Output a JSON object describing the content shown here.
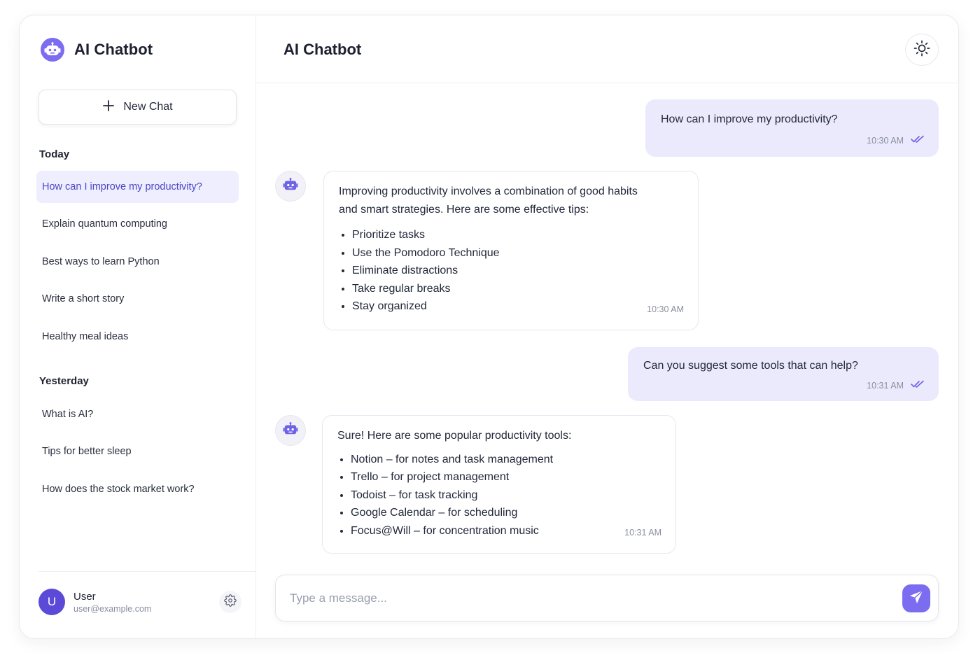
{
  "sidebar": {
    "brand_title": "AI Chatbot",
    "new_chat_label": "New Chat",
    "today_label": "Today",
    "yesterday_label": "Yesterday",
    "today_items": [
      {
        "label": "How can I improve my productivity?",
        "active": true
      },
      {
        "label": "Explain quantum computing"
      },
      {
        "label": "Best ways to learn Python"
      },
      {
        "label": "Write a short story"
      },
      {
        "label": "Healthy meal ideas"
      }
    ],
    "yesterday_items": [
      {
        "label": "What is AI?"
      },
      {
        "label": "Tips for better sleep"
      },
      {
        "label": "How does the stock market work?"
      }
    ],
    "user": {
      "initial": "U",
      "name": "User",
      "email": "user@example.com"
    }
  },
  "header": {
    "title": "AI Chatbot"
  },
  "messages": [
    {
      "role": "user",
      "text": "How can I improve my productivity?",
      "time": "10:30 AM"
    },
    {
      "role": "bot",
      "text_line1": "Improving productivity involves a combination of good habits",
      "text_line2": "and smart strategies. Here are some effective tips:",
      "list": [
        "Prioritize tasks",
        "Use the Pomodoro Technique",
        "Eliminate distractions",
        "Take regular breaks",
        "Stay organized"
      ],
      "time": "10:30 AM"
    },
    {
      "role": "user",
      "text": "Can you suggest some tools that can help?",
      "time": "10:31 AM"
    },
    {
      "role": "bot",
      "text_line1": "Sure! Here are some popular productivity tools:",
      "list": [
        "Notion – for notes and task management",
        "Trello – for project management",
        "Todoist – for task tracking",
        "Google Calendar – for scheduling",
        "Focus@Will – for concentration music"
      ],
      "time": "10:31 AM"
    }
  ],
  "composer": {
    "placeholder": "Type a message..."
  },
  "icons": {
    "brand": "robot-icon",
    "new_chat": "plus-icon",
    "settings": "gear-icon",
    "theme": "sun-icon",
    "read": "double-check-icon",
    "send": "paper-plane-icon"
  },
  "colors": {
    "accent": "#7b6cf0",
    "avatar": "#5b4ad8",
    "user_bubble": "#ebeafd",
    "active_item": "#efeefe",
    "active_text": "#4a46c8"
  }
}
